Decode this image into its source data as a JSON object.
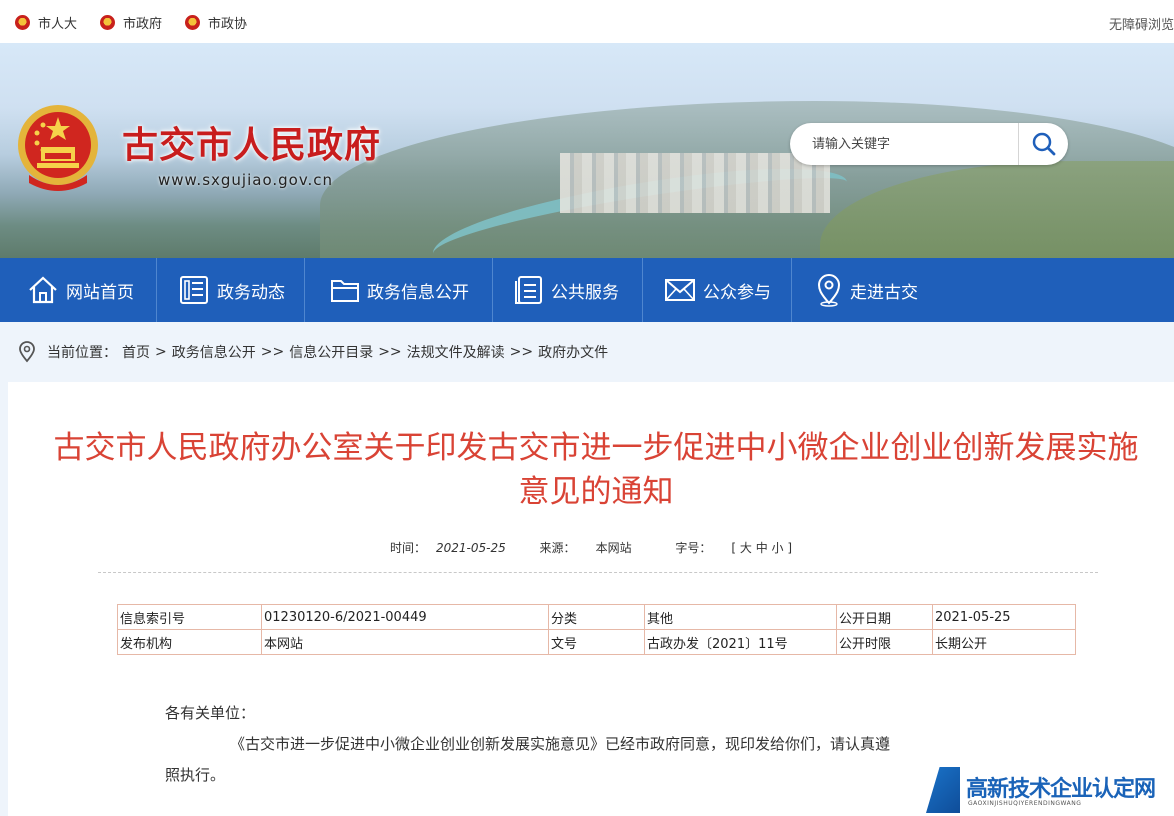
{
  "topbar": {
    "links": [
      "市人大",
      "市政府",
      "市政协"
    ],
    "accessibility": "无障碍浏览"
  },
  "banner": {
    "title": "古交市人民政府",
    "url": "www.sxgujiao.gov.cn",
    "search_placeholder": "请输入关键字"
  },
  "nav": {
    "items": [
      {
        "label": "网站首页",
        "icon": "home-icon"
      },
      {
        "label": "政务动态",
        "icon": "news-icon"
      },
      {
        "label": "政务信息公开",
        "icon": "folder-icon"
      },
      {
        "label": "公共服务",
        "icon": "document-icon"
      },
      {
        "label": "公众参与",
        "icon": "mail-icon"
      },
      {
        "label": "走进古交",
        "icon": "location-icon"
      }
    ]
  },
  "breadcrumb": {
    "prefix": "当前位置：",
    "items": [
      "首页",
      "政务信息公开",
      "信息公开目录",
      "法规文件及解读",
      "政府办文件"
    ],
    "sep1": ">",
    "sep2": ">>"
  },
  "article": {
    "title": "古交市人民政府办公室关于印发古交市进一步促进中小微企业创业创新发展实施意见的通知",
    "time_label": "时间：",
    "time": "2021-05-25",
    "source_label": "来源：",
    "source": "本网站",
    "font_label": "字号：",
    "font_sizes": "[ 大 中 小 ]",
    "info_table": [
      [
        "信息索引号",
        "01230120-6/2021-00449",
        "分类",
        "其他",
        "公开日期",
        "2021-05-25"
      ],
      [
        "发布机构",
        "本网站",
        "文号",
        "古政办发〔2021〕11号",
        "公开时限",
        "长期公开"
      ]
    ],
    "salutation": "各有关单位：",
    "para_line1": "《古交市进一步促进中小微企业创业创新发展实施意见》已经市政府同意，现印发给你们，请认真遵",
    "para_line2": "照执行。"
  },
  "watermark": {
    "text": "高新技术企业认定网",
    "sub": "GAOXINJISHUQIYERENDINGWANG"
  }
}
